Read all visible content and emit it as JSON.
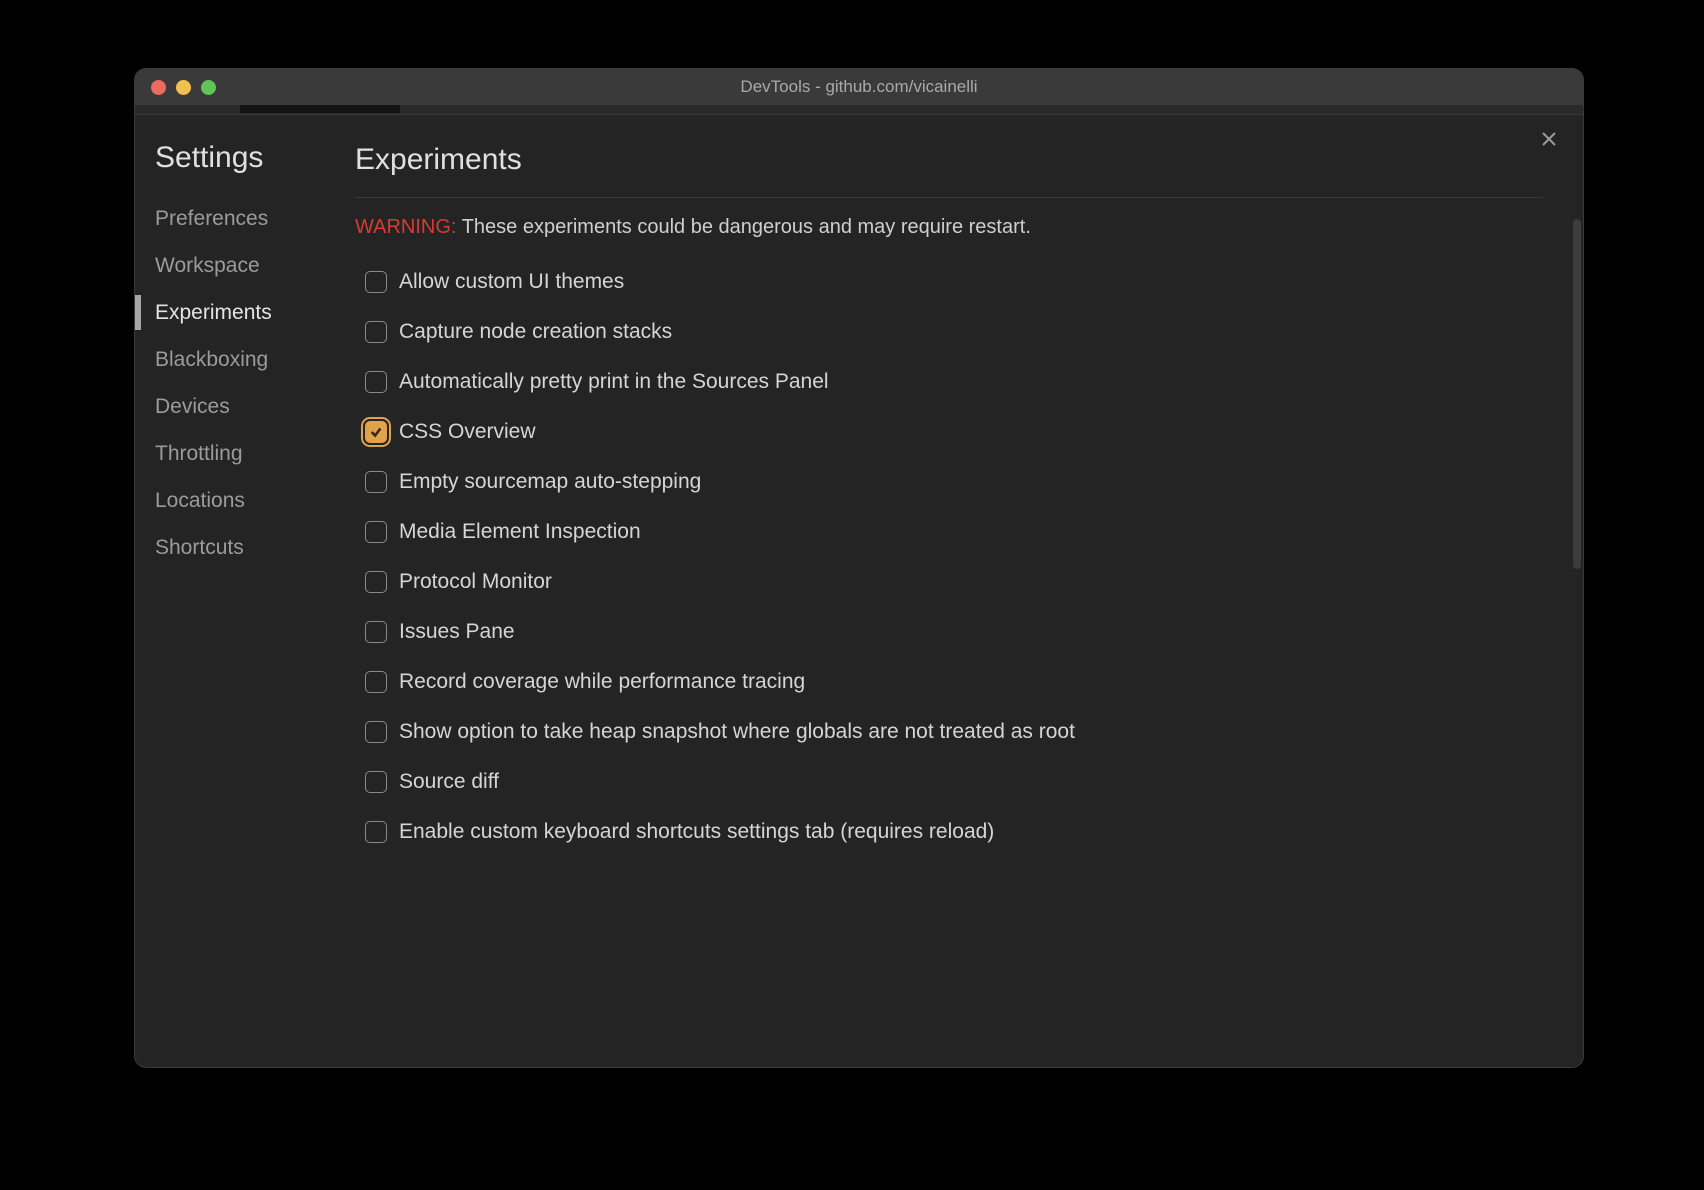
{
  "window": {
    "title": "DevTools - github.com/vicainelli"
  },
  "sidebar": {
    "title": "Settings",
    "items": [
      {
        "label": "Preferences"
      },
      {
        "label": "Workspace"
      },
      {
        "label": "Experiments",
        "selected": true
      },
      {
        "label": "Blackboxing"
      },
      {
        "label": "Devices"
      },
      {
        "label": "Throttling"
      },
      {
        "label": "Locations"
      },
      {
        "label": "Shortcuts"
      }
    ]
  },
  "main": {
    "title": "Experiments",
    "warning_label": "WARNING:",
    "warning_text": "These experiments could be dangerous and may require restart.",
    "experiments": [
      {
        "label": "Allow custom UI themes",
        "checked": false
      },
      {
        "label": "Capture node creation stacks",
        "checked": false
      },
      {
        "label": "Automatically pretty print in the Sources Panel",
        "checked": false
      },
      {
        "label": "CSS Overview",
        "checked": true
      },
      {
        "label": "Empty sourcemap auto-stepping",
        "checked": false
      },
      {
        "label": "Media Element Inspection",
        "checked": false
      },
      {
        "label": "Protocol Monitor",
        "checked": false
      },
      {
        "label": "Issues Pane",
        "checked": false
      },
      {
        "label": "Record coverage while performance tracing",
        "checked": false
      },
      {
        "label": "Show option to take heap snapshot where globals are not treated as root",
        "checked": false
      },
      {
        "label": "Source diff",
        "checked": false
      },
      {
        "label": "Enable custom keyboard shortcuts settings tab (requires reload)",
        "checked": false
      }
    ]
  }
}
